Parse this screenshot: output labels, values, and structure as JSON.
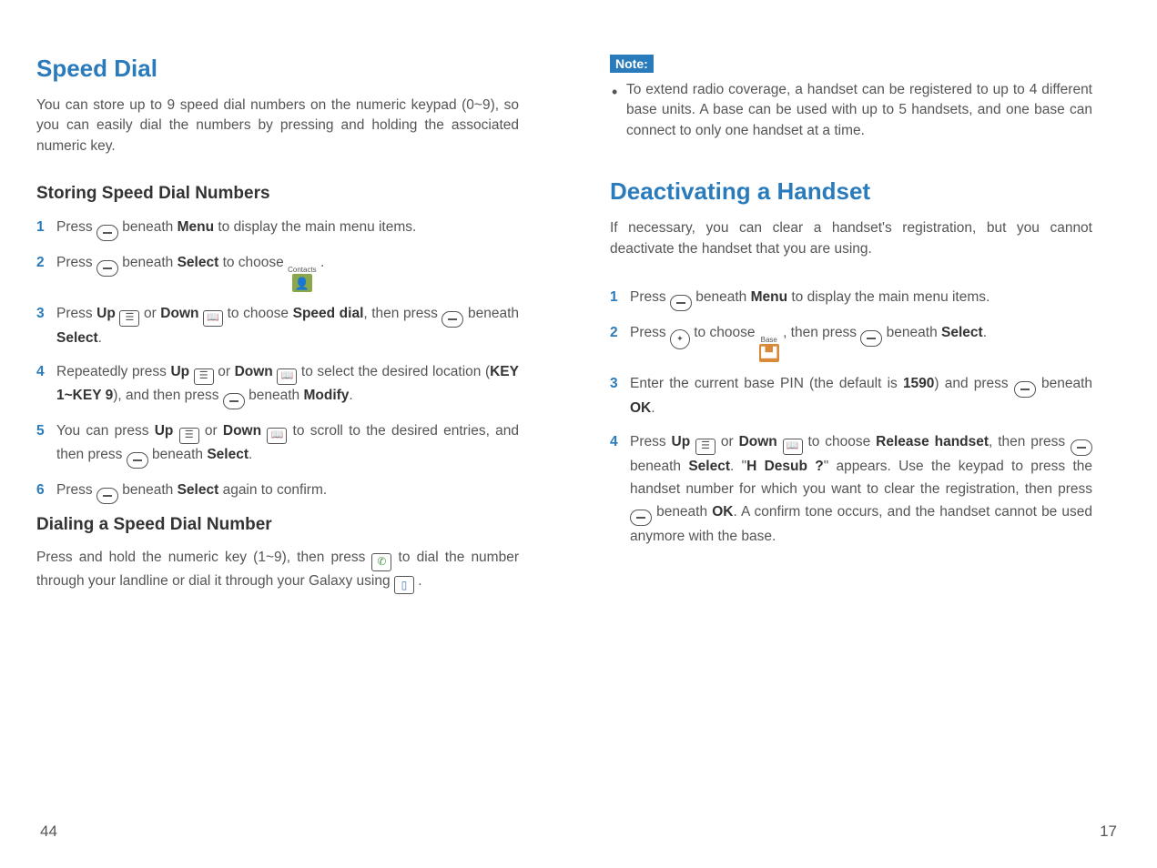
{
  "left": {
    "h1": "Speed Dial",
    "intro": "You can store up to 9 speed dial numbers on the numeric keypad (0~9), so you can easily dial the numbers by pressing and holding the associated numeric key.",
    "h2a": "Storing Speed Dial Numbers",
    "steps": [
      {
        "n": "1",
        "pre": "Press ",
        "mid": " beneath ",
        "bold1": "Menu",
        "post": " to display the main menu items."
      },
      {
        "n": "2",
        "pre": "Press ",
        "mid": " beneath ",
        "bold1": "Select",
        "post": " to choose ",
        "iconLabel": "Contacts",
        "end": " ."
      },
      {
        "n": "3",
        "pre": "Press ",
        "up": "Up",
        "or": " or ",
        "down": "Down",
        "mid": " to choose ",
        "bold1": "Speed dial",
        "post": ", then press ",
        "mid2": " beneath ",
        "bold2": "Select",
        "end": "."
      },
      {
        "n": "4",
        "pre": "Repeatedly press ",
        "up": "Up",
        "or": " or ",
        "down": "Down",
        "mid": " to select the desired location (",
        "bold1": "KEY 1~KEY 9",
        "post": "), and then press ",
        "mid2": " beneath ",
        "bold2": "Modify",
        "end": "."
      },
      {
        "n": "5",
        "pre": "You can press ",
        "up": "Up",
        "or": " or ",
        "down": "Down",
        "mid": " to scroll to the desired entries, and then press ",
        "mid2": " beneath ",
        "bold2": "Select",
        "end": "."
      },
      {
        "n": "6",
        "pre": "Press ",
        "mid": " beneath ",
        "bold1": "Select",
        "post": " again to confirm."
      }
    ],
    "h2b": "Dialing a Speed Dial Number",
    "dial": {
      "pre": "Press and hold the numeric key (1~9), then press ",
      "mid": " to dial the number through your landline or dial it through your Galaxy using ",
      "end": " ."
    }
  },
  "right": {
    "noteLabel": "Note:",
    "note": "To extend radio coverage, a handset can be registered to up to 4 different base units. A base can be used with up to 5 handsets, and one base can connect to only one handset at a time.",
    "h1": "Deactivating a Handset",
    "intro": "If necessary, you can clear a handset's registration, but you cannot deactivate the handset that you are using.",
    "steps": [
      {
        "n": "1",
        "pre": "Press ",
        "mid": " beneath ",
        "bold1": "Menu",
        "post": " to display the main menu items."
      },
      {
        "n": "2",
        "pre": "Press ",
        "mid": " to choose ",
        "iconLabel": "Base",
        "post2": " , then press ",
        "mid2": " beneath ",
        "bold2": "Select",
        "end": "."
      },
      {
        "n": "3",
        "pre": "Enter the current base PIN (the default is ",
        "bold1": "1590",
        "post": ") and press ",
        "mid2": " beneath ",
        "bold2": "OK",
        "end": "."
      },
      {
        "n": "4",
        "pre": "Press ",
        "up": "Up",
        "or": " or ",
        "down": "Down",
        "mid": " to choose ",
        "bold1": "Release handset",
        "post": ", then press ",
        "mid2": " beneath ",
        "bold2": "Select",
        "post2": ". \"",
        "bold3": "H Desub ?",
        "post3": "\" appears. Use the keypad to press the handset number for which you want to clear the registration, then press ",
        "mid3": " beneath ",
        "bold4": "OK",
        "end": ". A confirm tone occurs, and the handset cannot be used anymore with the base."
      }
    ]
  },
  "pageLeft": "44",
  "pageRight": "17"
}
